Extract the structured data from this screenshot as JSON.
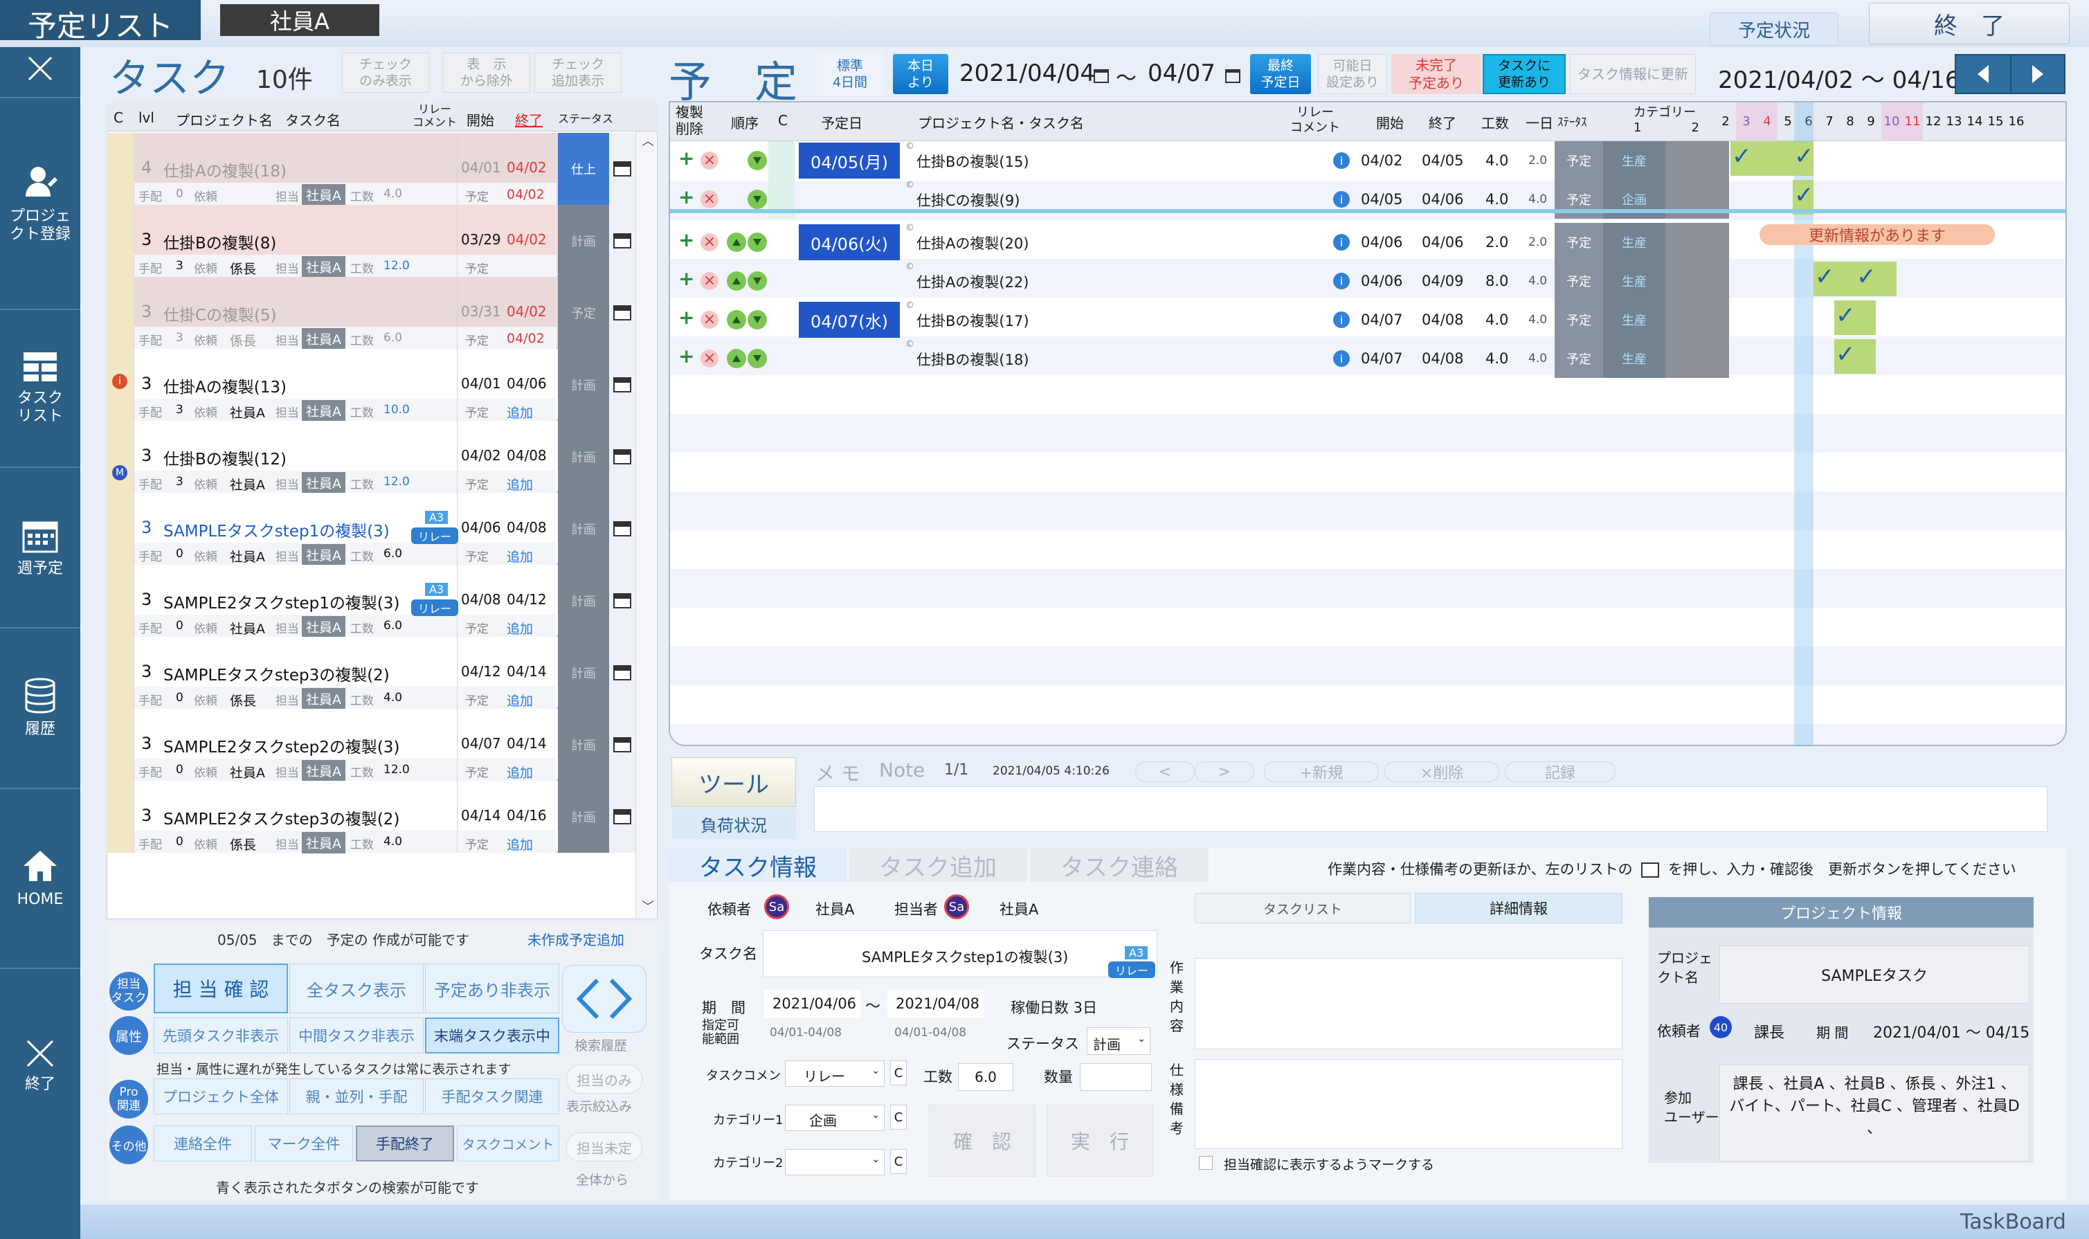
{
  "app": {
    "title": "予定リスト",
    "user": "社員A",
    "schedule_status": "予定状況",
    "exit": "終　了",
    "brand": "TaskBoard"
  },
  "sidebar": [
    {
      "label": "",
      "icon": "close-icon"
    },
    {
      "label": "プロジェ\nクト登録",
      "icon": "user-register-icon"
    },
    {
      "label": "タスク\nリスト",
      "icon": "task-list-icon"
    },
    {
      "label": "週予定",
      "icon": "calendar-icon"
    },
    {
      "label": "履歴",
      "icon": "database-icon"
    },
    {
      "label": "HOME",
      "icon": "home-icon"
    },
    {
      "label": "終了",
      "icon": "close-icon"
    }
  ],
  "tasks_panel": {
    "title": "タスク",
    "count": "10件",
    "check_only": "チェック\nのみ表示",
    "display_exclude": "表　示\nから除外",
    "check_add": "チェック\n追加表示",
    "columns": {
      "c": "C",
      "lvl": "lvl",
      "project": "プロジェクト名",
      "task": "タスク名",
      "relay": "リレー\nコメント",
      "start": "開始",
      "end": "終了",
      "status": "ステータス"
    },
    "rows": [
      {
        "lvl": "4",
        "name": "仕掛Aの複製(18)",
        "tehai": "0",
        "irai": "依頼",
        "irai_val": "",
        "tanto": "社員A",
        "kosu": "4.0",
        "start": "04/01",
        "end": "04/02",
        "plan": "予定",
        "plan_val": "04/02",
        "status": "仕上",
        "bg": "#ead9d9",
        "dim": true,
        "tag": "",
        "relay": ""
      },
      {
        "lvl": "3",
        "name": "仕掛Bの複製(8)",
        "tehai": "3",
        "irai": "依頼",
        "irai_val": "係長",
        "tanto": "社員A",
        "kosu": "12.0",
        "start": "03/29",
        "end": "04/02",
        "plan": "予定",
        "plan_val": "",
        "status": "計画",
        "bg": "#f4dcdc",
        "dim": false,
        "tag": "",
        "relay": ""
      },
      {
        "lvl": "3",
        "name": "仕掛Cの複製(5)",
        "tehai": "3",
        "irai": "依頼",
        "irai_val": "係長",
        "tanto": "社員A",
        "kosu": "6.0",
        "start": "03/31",
        "end": "04/02",
        "plan": "予定",
        "plan_val": "04/02",
        "status": "予定",
        "bg": "#ead9d9",
        "dim": true,
        "tag": "",
        "relay": ""
      },
      {
        "lvl": "3",
        "name": "仕掛Aの複製(13)",
        "tehai": "3",
        "irai": "依頼",
        "irai_val": "社員A",
        "tanto": "社員A",
        "kosu": "10.0",
        "start": "04/01",
        "end": "04/06",
        "plan": "予定",
        "plan_val": "追加",
        "status": "計画",
        "bg": "#ffffff",
        "dim": false,
        "tag": "",
        "relay": ""
      },
      {
        "lvl": "3",
        "name": "仕掛Bの複製(12)",
        "tehai": "3",
        "irai": "依頼",
        "irai_val": "社員A",
        "tanto": "社員A",
        "kosu": "12.0",
        "start": "04/02",
        "end": "04/08",
        "plan": "予定",
        "plan_val": "追加",
        "status": "計画",
        "bg": "#ffffff",
        "dim": false,
        "tag": "",
        "relay": ""
      },
      {
        "lvl": "3",
        "name": "SAMPLEタスクstep1の複製(3)",
        "tehai": "0",
        "irai": "依頼",
        "irai_val": "社員A",
        "tanto": "社員A",
        "kosu": "6.0",
        "start": "04/06",
        "end": "04/08",
        "plan": "予定",
        "plan_val": "追加",
        "status": "計画",
        "bg": "#ffffff",
        "dim": false,
        "tag": "A3",
        "relay": "リレー",
        "blue": true
      },
      {
        "lvl": "3",
        "name": "SAMPLE2タスクstep1の複製(3)",
        "tehai": "0",
        "irai": "依頼",
        "irai_val": "社員A",
        "tanto": "社員A",
        "kosu": "6.0",
        "start": "04/08",
        "end": "04/12",
        "plan": "予定",
        "plan_val": "追加",
        "status": "計画",
        "bg": "#ffffff",
        "dim": false,
        "tag": "A3",
        "relay": "リレー"
      },
      {
        "lvl": "3",
        "name": "SAMPLEタスクstep3の複製(2)",
        "tehai": "0",
        "irai": "依頼",
        "irai_val": "係長",
        "tanto": "社員A",
        "kosu": "4.0",
        "start": "04/12",
        "end": "04/14",
        "plan": "予定",
        "plan_val": "追加",
        "status": "計画",
        "bg": "#ffffff",
        "dim": false,
        "tag": "",
        "relay": ""
      },
      {
        "lvl": "3",
        "name": "SAMPLE2タスクstep2の複製(3)",
        "tehai": "0",
        "irai": "依頼",
        "irai_val": "社員A",
        "tanto": "社員A",
        "kosu": "12.0",
        "start": "04/07",
        "end": "04/14",
        "plan": "予定",
        "plan_val": "追加",
        "status": "計画",
        "bg": "#ffffff",
        "dim": false,
        "tag": "",
        "relay": ""
      },
      {
        "lvl": "3",
        "name": "SAMPLE2タスクstep3の複製(2)",
        "tehai": "0",
        "irai": "依頼",
        "irai_val": "係長",
        "tanto": "社員A",
        "kosu": "4.0",
        "start": "04/14",
        "end": "04/16",
        "plan": "予定",
        "plan_val": "追加",
        "status": "計画",
        "bg": "#ffffff",
        "dim": false,
        "tag": "",
        "relay": ""
      }
    ],
    "labels": {
      "tehai": "手配",
      "tanto": "担当",
      "kosu": "工数"
    },
    "footer_text": "05/05　までの　予定の 作成が可能です",
    "footer_link": "未作成予定追加"
  },
  "filters": {
    "side1": "担当\nタスク",
    "side2": "属性",
    "side3": "Pro\n関連",
    "side4": "その他",
    "r1": [
      "担 当 確 認",
      "全タスク表示",
      "予定あり非表示"
    ],
    "r2": [
      "先頭タスク非表示",
      "中間タスク非表示",
      "末端タスク表示中"
    ],
    "note": "担当・属性に遅れが発生しているタスクは常に表示されます",
    "r3": [
      "プロジェクト全体",
      "親・並列・手配",
      "手配タスク関連"
    ],
    "r4": [
      "連絡全件",
      "マーク全件",
      "手配終了",
      "タスクコメント"
    ],
    "history": "検索履歴",
    "only": "担当のみ",
    "only2": "表示絞込み",
    "unset": "担当未定",
    "unset2": "全体から",
    "footer": "青く表示されたタボタンの検索が可能です"
  },
  "schedule": {
    "title": "予　定",
    "std": "標準\n4日間",
    "today": "本日\nより",
    "from": "2021/04/04",
    "tilde": "～",
    "to": "04/07",
    "latest": "最終\n予定日",
    "possible": "可能日\n設定あり",
    "incomplete": "未完了\n予定あり",
    "updated": "タスクに\n更新あり",
    "refresh": "タスク情報に更新",
    "range": "2021/04/02 ～ 04/16",
    "columns": {
      "dup": "複製\n削除",
      "order": "順序",
      "c": "C",
      "date": "予定日",
      "name": "プロジェクト名・タスク名",
      "relay": "リレー\nコメント",
      "start": "開始",
      "end": "終了",
      "kosu": "工数",
      "day": "一日",
      "status": "ｽﾃｰﾀｽ",
      "cat": "カテゴリー\n1　　　　2"
    },
    "days": [
      "2",
      "3",
      "4",
      "5",
      "6",
      "7",
      "8",
      "9",
      "10",
      "11",
      "12",
      "13",
      "14",
      "15",
      "16"
    ],
    "rows": [
      {
        "date": "04/05(月)",
        "name": "仕掛Bの複製(15)",
        "start": "04/02",
        "end": "04/05",
        "kosu": "4.0",
        "day": "2.0",
        "status": "予定",
        "cat": "生産",
        "arrows": 1
      },
      {
        "date": "",
        "name": "仕掛Cの複製(9)",
        "start": "04/05",
        "end": "04/06",
        "kosu": "4.0",
        "day": "4.0",
        "status": "予定",
        "cat": "企画",
        "arrows": 1
      },
      {
        "date": "04/06(火)",
        "name": "仕掛Aの複製(20)",
        "start": "04/06",
        "end": "04/06",
        "kosu": "2.0",
        "day": "2.0",
        "status": "予定",
        "cat": "生産",
        "arrows": 2
      },
      {
        "date": "",
        "name": "仕掛Aの複製(22)",
        "start": "04/06",
        "end": "04/09",
        "kosu": "8.0",
        "day": "4.0",
        "status": "予定",
        "cat": "生産",
        "arrows": 2
      },
      {
        "date": "04/07(水)",
        "name": "仕掛Bの複製(17)",
        "start": "04/07",
        "end": "04/08",
        "kosu": "4.0",
        "day": "4.0",
        "status": "予定",
        "cat": "生産",
        "arrows": 2
      },
      {
        "date": "",
        "name": "仕掛Bの複製(18)",
        "start": "04/07",
        "end": "04/08",
        "kosu": "4.0",
        "day": "4.0",
        "status": "予定",
        "cat": "生産",
        "arrows": 2
      }
    ],
    "update_banner": "更新情報があります"
  },
  "tool": {
    "tool": "ツール",
    "load": "負荷状況",
    "memo": "メ モ",
    "note": "Note",
    "page": "1/1",
    "time": "2021/04/05 4:10:26",
    "prev": "<",
    "next": ">",
    "new": "+新規",
    "del": "×削除",
    "save": "記録"
  },
  "task_info": {
    "tabs": [
      "タスク情報",
      "タスク追加",
      "タスク連絡"
    ],
    "hint": "作業内容・仕様備考の更新ほか、左のリストの",
    "hint2": "を押し、入力・確認後　更新ボタンを押してください",
    "requester": "依頼者",
    "requester_name": "社員A",
    "assignee": "担当者",
    "assignee_name": "社員A",
    "avatar": "Sa",
    "task_name_label": "タスク名",
    "task_name": "SAMPLEタスクstep1の複製(3)",
    "tag": "A3",
    "relay": "リレー",
    "period": "期　間",
    "from": "2021/04/06",
    "to": "2021/04/08",
    "days": "稼働日数 3日",
    "possible": "指定可\n能範囲",
    "pfrom": "04/01-04/08",
    "pto": "04/01-04/08",
    "status_label": "ステータス",
    "status": "計画",
    "comment_label": "タスクコメント",
    "comment": "リレー",
    "kosu_label": "工数",
    "kosu": "6.0",
    "qty_label": "数量",
    "cat1_label": "カテゴリー1",
    "cat1": "企画",
    "cat2_label": "カテゴリー2",
    "confirm": "確　認",
    "exec": "実　行",
    "tasklist": "タスクリスト",
    "detail": "詳細情報",
    "work": "作\n業\n内\n容",
    "spec": "仕\n様\n備\n考",
    "mark": "担当確認に表示するようマークする"
  },
  "project": {
    "header": "プロジェクト情報",
    "name_label": "プロジェ\nクト名",
    "name": "SAMPLEタスク",
    "req_label": "依頼者",
    "req_badge": "40",
    "req": "課長",
    "period_label": "期 間",
    "period": "2021/04/01 ～ 04/15",
    "users_label": "参加\nユーザー",
    "users": "課長 、社員A 、社員B 、係長 、外注1 、バイト、パート、社員C 、管理者 、社員D 、"
  }
}
